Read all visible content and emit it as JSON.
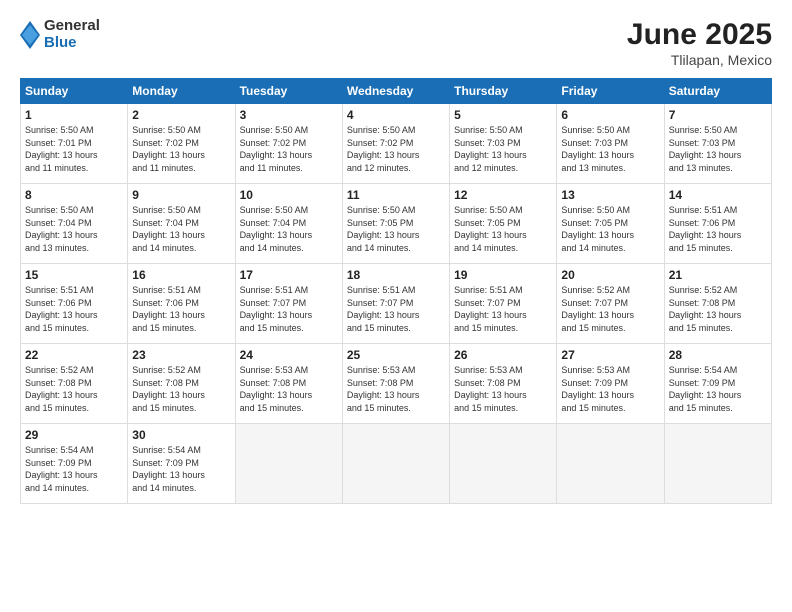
{
  "logo": {
    "general": "General",
    "blue": "Blue"
  },
  "title": "June 2025",
  "subtitle": "Tlilapan, Mexico",
  "days_header": [
    "Sunday",
    "Monday",
    "Tuesday",
    "Wednesday",
    "Thursday",
    "Friday",
    "Saturday"
  ],
  "weeks": [
    [
      {
        "day": "1",
        "info": "Sunrise: 5:50 AM\nSunset: 7:01 PM\nDaylight: 13 hours\nand 11 minutes."
      },
      {
        "day": "2",
        "info": "Sunrise: 5:50 AM\nSunset: 7:02 PM\nDaylight: 13 hours\nand 11 minutes."
      },
      {
        "day": "3",
        "info": "Sunrise: 5:50 AM\nSunset: 7:02 PM\nDaylight: 13 hours\nand 11 minutes."
      },
      {
        "day": "4",
        "info": "Sunrise: 5:50 AM\nSunset: 7:02 PM\nDaylight: 13 hours\nand 12 minutes."
      },
      {
        "day": "5",
        "info": "Sunrise: 5:50 AM\nSunset: 7:03 PM\nDaylight: 13 hours\nand 12 minutes."
      },
      {
        "day": "6",
        "info": "Sunrise: 5:50 AM\nSunset: 7:03 PM\nDaylight: 13 hours\nand 13 minutes."
      },
      {
        "day": "7",
        "info": "Sunrise: 5:50 AM\nSunset: 7:03 PM\nDaylight: 13 hours\nand 13 minutes."
      }
    ],
    [
      {
        "day": "8",
        "info": "Sunrise: 5:50 AM\nSunset: 7:04 PM\nDaylight: 13 hours\nand 13 minutes."
      },
      {
        "day": "9",
        "info": "Sunrise: 5:50 AM\nSunset: 7:04 PM\nDaylight: 13 hours\nand 14 minutes."
      },
      {
        "day": "10",
        "info": "Sunrise: 5:50 AM\nSunset: 7:04 PM\nDaylight: 13 hours\nand 14 minutes."
      },
      {
        "day": "11",
        "info": "Sunrise: 5:50 AM\nSunset: 7:05 PM\nDaylight: 13 hours\nand 14 minutes."
      },
      {
        "day": "12",
        "info": "Sunrise: 5:50 AM\nSunset: 7:05 PM\nDaylight: 13 hours\nand 14 minutes."
      },
      {
        "day": "13",
        "info": "Sunrise: 5:50 AM\nSunset: 7:05 PM\nDaylight: 13 hours\nand 14 minutes."
      },
      {
        "day": "14",
        "info": "Sunrise: 5:51 AM\nSunset: 7:06 PM\nDaylight: 13 hours\nand 15 minutes."
      }
    ],
    [
      {
        "day": "15",
        "info": "Sunrise: 5:51 AM\nSunset: 7:06 PM\nDaylight: 13 hours\nand 15 minutes."
      },
      {
        "day": "16",
        "info": "Sunrise: 5:51 AM\nSunset: 7:06 PM\nDaylight: 13 hours\nand 15 minutes."
      },
      {
        "day": "17",
        "info": "Sunrise: 5:51 AM\nSunset: 7:07 PM\nDaylight: 13 hours\nand 15 minutes."
      },
      {
        "day": "18",
        "info": "Sunrise: 5:51 AM\nSunset: 7:07 PM\nDaylight: 13 hours\nand 15 minutes."
      },
      {
        "day": "19",
        "info": "Sunrise: 5:51 AM\nSunset: 7:07 PM\nDaylight: 13 hours\nand 15 minutes."
      },
      {
        "day": "20",
        "info": "Sunrise: 5:52 AM\nSunset: 7:07 PM\nDaylight: 13 hours\nand 15 minutes."
      },
      {
        "day": "21",
        "info": "Sunrise: 5:52 AM\nSunset: 7:08 PM\nDaylight: 13 hours\nand 15 minutes."
      }
    ],
    [
      {
        "day": "22",
        "info": "Sunrise: 5:52 AM\nSunset: 7:08 PM\nDaylight: 13 hours\nand 15 minutes."
      },
      {
        "day": "23",
        "info": "Sunrise: 5:52 AM\nSunset: 7:08 PM\nDaylight: 13 hours\nand 15 minutes."
      },
      {
        "day": "24",
        "info": "Sunrise: 5:53 AM\nSunset: 7:08 PM\nDaylight: 13 hours\nand 15 minutes."
      },
      {
        "day": "25",
        "info": "Sunrise: 5:53 AM\nSunset: 7:08 PM\nDaylight: 13 hours\nand 15 minutes."
      },
      {
        "day": "26",
        "info": "Sunrise: 5:53 AM\nSunset: 7:08 PM\nDaylight: 13 hours\nand 15 minutes."
      },
      {
        "day": "27",
        "info": "Sunrise: 5:53 AM\nSunset: 7:09 PM\nDaylight: 13 hours\nand 15 minutes."
      },
      {
        "day": "28",
        "info": "Sunrise: 5:54 AM\nSunset: 7:09 PM\nDaylight: 13 hours\nand 15 minutes."
      }
    ],
    [
      {
        "day": "29",
        "info": "Sunrise: 5:54 AM\nSunset: 7:09 PM\nDaylight: 13 hours\nand 14 minutes."
      },
      {
        "day": "30",
        "info": "Sunrise: 5:54 AM\nSunset: 7:09 PM\nDaylight: 13 hours\nand 14 minutes."
      },
      {
        "day": "",
        "info": ""
      },
      {
        "day": "",
        "info": ""
      },
      {
        "day": "",
        "info": ""
      },
      {
        "day": "",
        "info": ""
      },
      {
        "day": "",
        "info": ""
      }
    ]
  ]
}
